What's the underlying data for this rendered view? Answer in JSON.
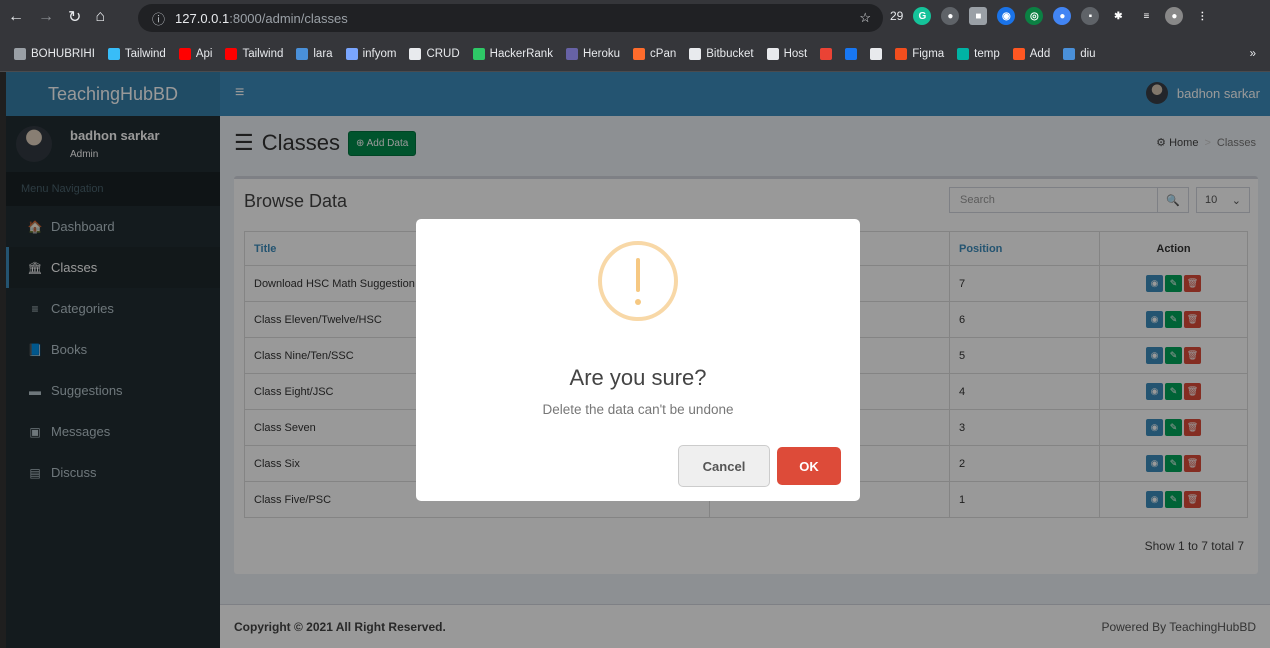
{
  "browser": {
    "url_host": "127.0.0.1",
    "url_rest": ":8000/admin/classes",
    "ext_count": "29",
    "bookmarks": [
      {
        "label": "BOHUBRIHI",
        "color": "#9aa0a6"
      },
      {
        "label": "Tailwind",
        "color": "#38bdf8"
      },
      {
        "label": "Api",
        "color": "#ff0000"
      },
      {
        "label": "Tailwind",
        "color": "#ff0000"
      },
      {
        "label": "lara",
        "color": "#4a90d9"
      },
      {
        "label": "infyom",
        "color": "#7aa6ff"
      },
      {
        "label": "CRUD",
        "color": "#e8eaed"
      },
      {
        "label": "HackerRank",
        "color": "#2ec866"
      },
      {
        "label": "Heroku",
        "color": "#6762a6"
      },
      {
        "label": "cPan",
        "color": "#ff6c2c"
      },
      {
        "label": "Bitbucket",
        "color": "#e8eaed"
      },
      {
        "label": "Host",
        "color": "#e8eaed"
      },
      {
        "label": "",
        "color": "#ea4335"
      },
      {
        "label": "",
        "color": "#1877f2"
      },
      {
        "label": "",
        "color": "#e8eaed"
      },
      {
        "label": "Figma",
        "color": "#f24e1e"
      },
      {
        "label": "temp",
        "color": "#00b3a4"
      },
      {
        "label": "Add",
        "color": "#ff5722"
      },
      {
        "label": "diu",
        "color": "#4a90d9"
      }
    ],
    "more": "»"
  },
  "app": {
    "brand": "TeachingHubBD",
    "user_name": "badhon sarkar",
    "user_role": "Admin",
    "menu_header": "Menu Navigation",
    "menu": [
      {
        "label": "Dashboard",
        "icon": "home-icon",
        "glyph": "🏠",
        "active": false
      },
      {
        "label": "Classes",
        "icon": "bank-icon",
        "glyph": "🏛",
        "active": true
      },
      {
        "label": "Categories",
        "icon": "bars-icon",
        "glyph": "≡",
        "active": false
      },
      {
        "label": "Books",
        "icon": "book-icon",
        "glyph": "📘",
        "active": false
      },
      {
        "label": "Suggestions",
        "icon": "archive-icon",
        "glyph": "▬",
        "active": false
      },
      {
        "label": "Messages",
        "icon": "message-icon",
        "glyph": "▣",
        "active": false
      },
      {
        "label": "Discuss",
        "icon": "list-icon",
        "glyph": "▤",
        "active": false
      }
    ]
  },
  "page": {
    "title": "Classes",
    "add_label": "Add Data",
    "breadcrumb": {
      "home": "Home",
      "sep": ">",
      "current": "Classes"
    }
  },
  "box": {
    "title": "Browse Data",
    "search_placeholder": "Search",
    "page_size": "10"
  },
  "table": {
    "headers": {
      "title": "Title",
      "position": "Position",
      "action": "Action"
    },
    "rows": [
      {
        "title": "Download HSC Math Suggestion",
        "position": "7"
      },
      {
        "title": "Class Eleven/Twelve/HSC",
        "position": "6"
      },
      {
        "title": "Class Nine/Ten/SSC",
        "position": "5"
      },
      {
        "title": "Class Eight/JSC",
        "position": "4"
      },
      {
        "title": "Class Seven",
        "position": "3"
      },
      {
        "title": "Class Six",
        "position": "2"
      },
      {
        "title": "Class Five/PSC",
        "position": "1"
      }
    ],
    "summary": "Show 1 to 7 total 7"
  },
  "footer": {
    "copyright": "Copyright © 2021 All Right Reserved.",
    "powered": "Powered By TeachingHubBD"
  },
  "modal": {
    "title": "Are you sure?",
    "text": "Delete the data can't be undone",
    "cancel": "Cancel",
    "ok": "OK",
    "icon": "warning-icon"
  }
}
